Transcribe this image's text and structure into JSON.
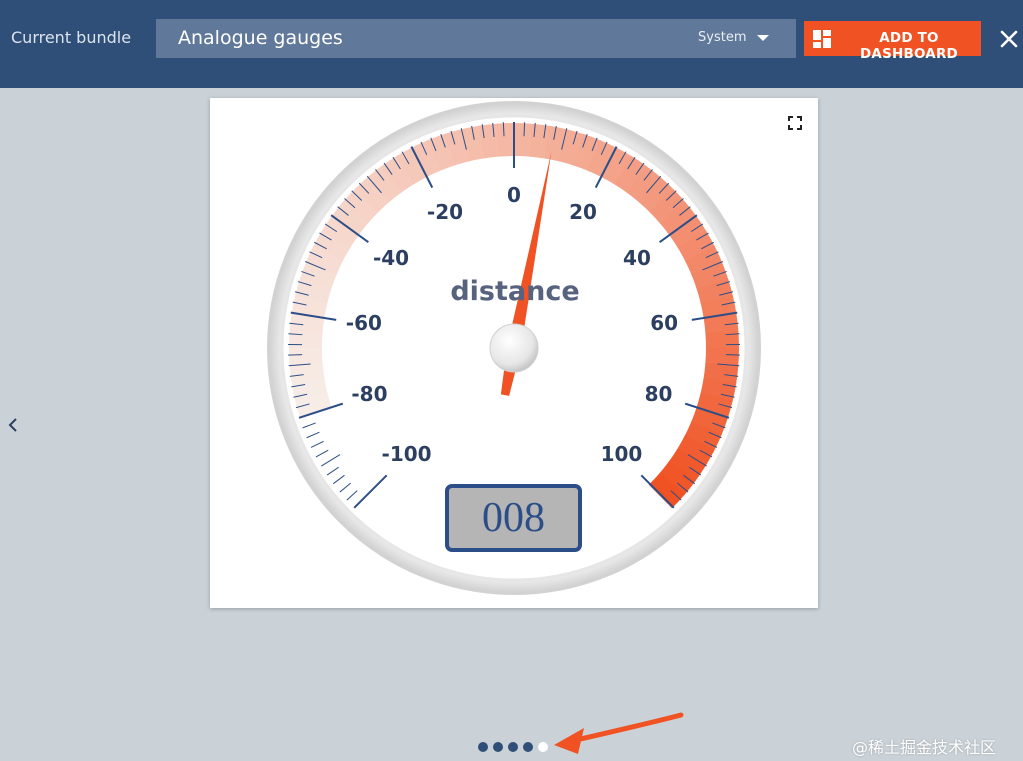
{
  "header": {
    "bundle_label": "Current bundle",
    "selected_bundle": "Analogue gauges",
    "bundle_scope": "System",
    "add_button_label": "ADD TO DASHBOARD"
  },
  "gauge": {
    "title": "distance",
    "readout": "008",
    "value": 8,
    "min": -100,
    "max": 100,
    "major_ticks": [
      "-100",
      "-80",
      "-60",
      "-40",
      "-20",
      "0",
      "20",
      "40",
      "60",
      "80",
      "100"
    ],
    "colors": {
      "accent": "#f05223",
      "tick": "#2c4e88",
      "readout_border": "#2c4e88",
      "readout_bg": "#b5b5b5"
    }
  },
  "pager": {
    "count": 5,
    "active_index": 4
  },
  "watermark": "@稀土掘金技术社区",
  "icons": {
    "dashboard": "dashboard-icon",
    "dropdown": "chevron-down-icon",
    "close": "close-icon",
    "prev": "chevron-left-icon",
    "fullscreen": "fullscreen-icon"
  }
}
